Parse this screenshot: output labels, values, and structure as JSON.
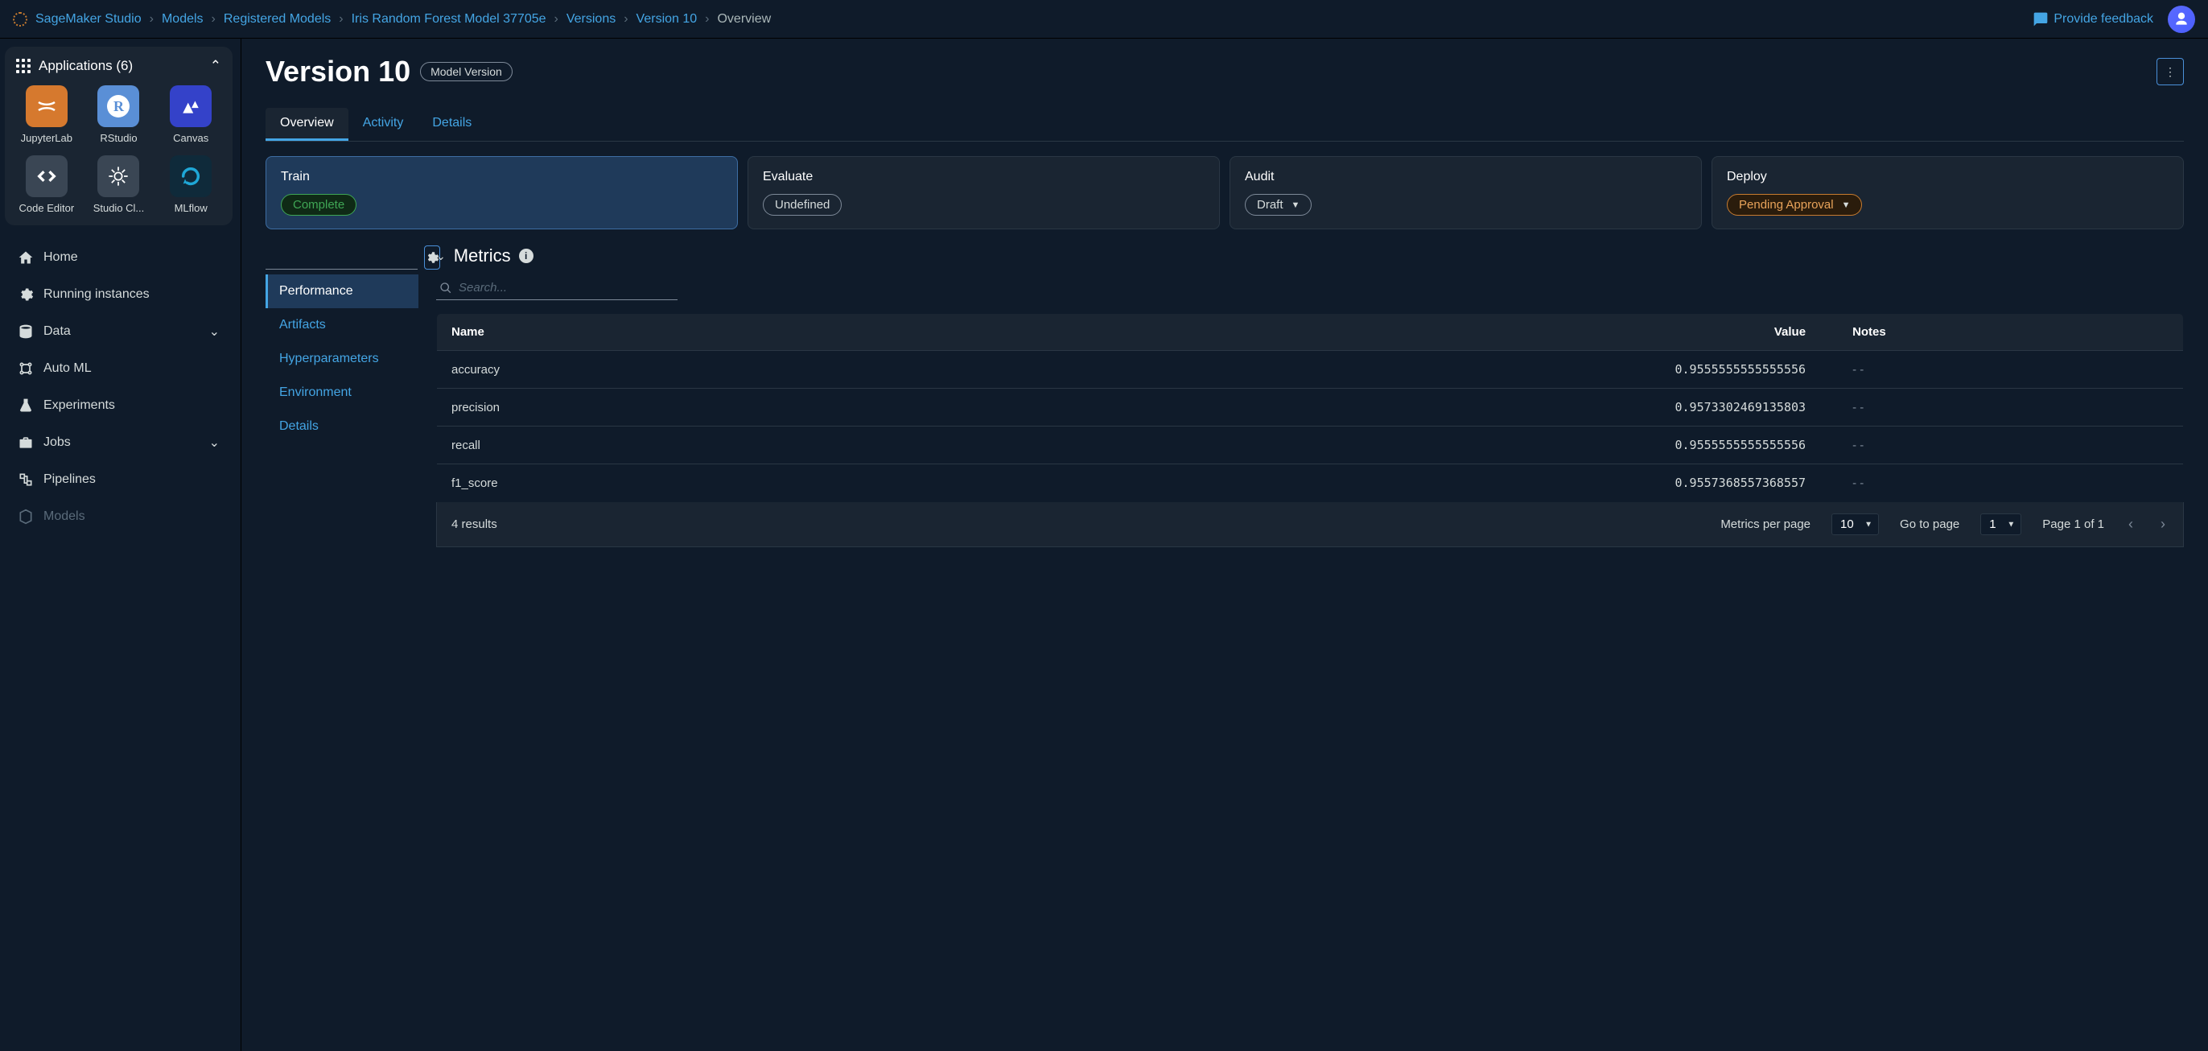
{
  "breadcrumbs": [
    "SageMaker Studio",
    "Models",
    "Registered Models",
    "Iris Random Forest Model 37705e",
    "Versions",
    "Version 10",
    "Overview"
  ],
  "feedback_label": "Provide feedback",
  "apps": {
    "header": "Applications (6)",
    "items": [
      {
        "label": "JupyterLab",
        "bg": "#d6792e"
      },
      {
        "label": "RStudio",
        "bg": "#5a8fd6"
      },
      {
        "label": "Canvas",
        "bg": "#3442c9"
      },
      {
        "label": "Code Editor",
        "bg": "#3a4654"
      },
      {
        "label": "Studio Cl...",
        "bg": "#3a4654"
      },
      {
        "label": "MLflow",
        "bg": "#0f2a3a"
      }
    ]
  },
  "nav": {
    "home": "Home",
    "running": "Running instances",
    "data": "Data",
    "automl": "Auto ML",
    "experiments": "Experiments",
    "jobs": "Jobs",
    "pipelines": "Pipelines",
    "models": "Models"
  },
  "page": {
    "title": "Version 10",
    "badge": "Model Version"
  },
  "tabs": {
    "overview": "Overview",
    "activity": "Activity",
    "details": "Details"
  },
  "stages": {
    "train": {
      "title": "Train",
      "status": "Complete"
    },
    "evaluate": {
      "title": "Evaluate",
      "status": "Undefined"
    },
    "audit": {
      "title": "Audit",
      "status": "Draft"
    },
    "deploy": {
      "title": "Deploy",
      "status": "Pending Approval"
    }
  },
  "subtabs": {
    "performance": "Performance",
    "artifacts": "Artifacts",
    "hyperparameters": "Hyperparameters",
    "environment": "Environment",
    "details": "Details"
  },
  "metrics": {
    "title": "Metrics",
    "search_placeholder": "Search...",
    "columns": {
      "name": "Name",
      "value": "Value",
      "notes": "Notes"
    },
    "rows": [
      {
        "name": "accuracy",
        "value": "0.9555555555555556",
        "notes": "- -"
      },
      {
        "name": "precision",
        "value": "0.9573302469135803",
        "notes": "- -"
      },
      {
        "name": "recall",
        "value": "0.9555555555555556",
        "notes": "- -"
      },
      {
        "name": "f1_score",
        "value": "0.9557368557368557",
        "notes": "- -"
      }
    ],
    "footer": {
      "results": "4 results",
      "per_page_label": "Metrics per page",
      "per_page_value": "10",
      "goto_label": "Go to page",
      "goto_value": "1",
      "page_text": "Page 1 of 1"
    }
  }
}
